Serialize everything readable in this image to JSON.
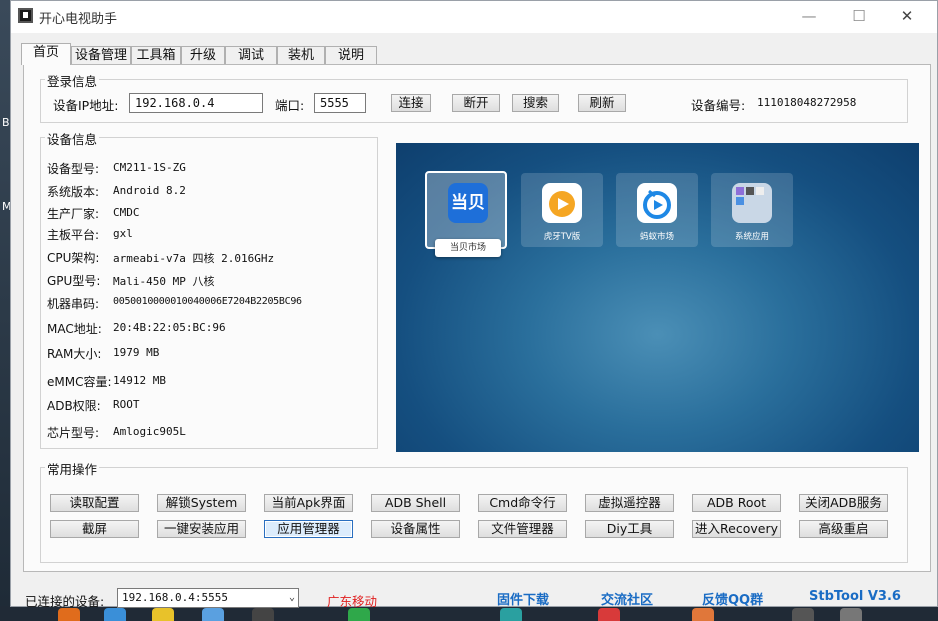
{
  "window": {
    "title": "开心电视助手",
    "controls": {
      "minimize": "—",
      "maximize": "☐",
      "close": "✕"
    }
  },
  "tabs": [
    {
      "label": "首页",
      "active": true
    },
    {
      "label": "设备管理"
    },
    {
      "label": "工具箱"
    },
    {
      "label": "升级"
    },
    {
      "label": "调试"
    },
    {
      "label": "装机"
    },
    {
      "label": "说明"
    }
  ],
  "login": {
    "group_title": "登录信息",
    "ip_label": "设备IP地址:",
    "ip_value": "192.168.0.4",
    "port_label": "端口:",
    "port_value": "5555",
    "buttons": {
      "connect": "连接",
      "disconnect": "断开",
      "search": "搜索",
      "refresh": "刷新"
    },
    "device_no_label": "设备编号:",
    "device_no_value": "111018048272958"
  },
  "device_info": {
    "group_title": "设备信息",
    "rows": [
      {
        "key": "设备型号:",
        "value": "CM211-1S-ZG"
      },
      {
        "key": "系统版本:",
        "value": "Android 8.2"
      },
      {
        "key": "生产厂家:",
        "value": "CMDC"
      },
      {
        "key": "主板平台:",
        "value": "gxl"
      },
      {
        "key": "CPU架构:",
        "value": "armeabi-v7a 四核 2.016GHz"
      },
      {
        "key": "GPU型号:",
        "value": "Mali-450 MP 八核"
      },
      {
        "key": "机器串码:",
        "value": "0050010000010040006E7204B2205BC96"
      },
      {
        "key": "MAC地址:",
        "value": "20:4B:22:05:BC:96"
      },
      {
        "key": "RAM大小:",
        "value": "1979 MB"
      },
      {
        "key": "eMMC容量:",
        "value": "14912 MB"
      },
      {
        "key": "ADB权限:",
        "value": "ROOT"
      },
      {
        "key": "芯片型号:",
        "value": "Amlogic905L"
      }
    ]
  },
  "tv_screen": {
    "focused_label": "当贝市场",
    "apps": [
      {
        "name": "当贝市场",
        "icon_text": "当贝",
        "color": "#1e6fd9",
        "focused": true
      },
      {
        "name": "虎牙TV版",
        "icon_text": "",
        "color": "#ffffff"
      },
      {
        "name": "蚂蚁市场",
        "icon_text": "",
        "color": "#ffffff"
      },
      {
        "name": "系统应用",
        "icon_text": "",
        "color": "#c9d7e6"
      }
    ]
  },
  "common_ops": {
    "group_title": "常用操作",
    "row1": [
      "读取配置",
      "解锁System",
      "当前Apk界面",
      "ADB Shell",
      "Cmd命令行",
      "虚拟遥控器",
      "ADB  Root",
      "关闭ADB服务"
    ],
    "row2": [
      "截屏",
      "一键安装应用",
      "应用管理器",
      "设备属性",
      "文件管理器",
      "Diy工具",
      "进入Recovery",
      "高级重启"
    ]
  },
  "status": {
    "connected_label": "已连接的设备:",
    "connected_value": "192.168.0.4:5555",
    "carrier": "广东移动",
    "carrier_color": "#e02020",
    "links": [
      "固件下载",
      "交流社区",
      "反馈QQ群",
      "StbTool V3.6"
    ],
    "link_color": "#1a6cc4"
  }
}
